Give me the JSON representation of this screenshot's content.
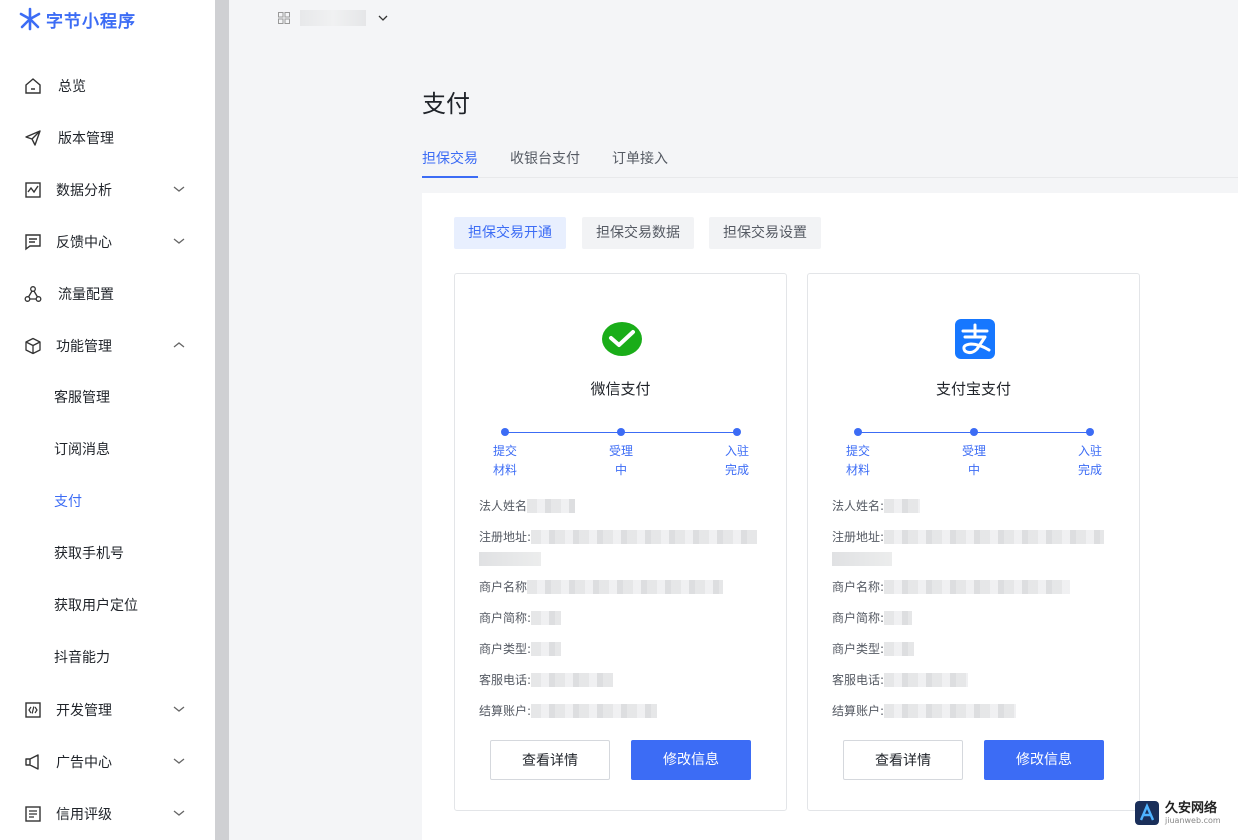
{
  "app": {
    "logo_text": "字节小程序"
  },
  "sidebar": {
    "items": [
      {
        "label": "总览",
        "icon": "home-icon"
      },
      {
        "label": "版本管理",
        "icon": "send-icon"
      },
      {
        "label": "数据分析",
        "icon": "chart-icon",
        "expandable": true
      },
      {
        "label": "反馈中心",
        "icon": "message-icon",
        "expandable": true
      },
      {
        "label": "流量配置",
        "icon": "share-icon"
      },
      {
        "label": "功能管理",
        "icon": "cube-icon",
        "expanded": true
      },
      {
        "label": "开发管理",
        "icon": "code-icon",
        "expandable": true
      },
      {
        "label": "广告中心",
        "icon": "megaphone-icon",
        "expandable": true
      },
      {
        "label": "信用评级",
        "icon": "document-icon",
        "expandable": true
      }
    ],
    "sub_items": [
      "客服管理",
      "订阅消息",
      "支付",
      "获取手机号",
      "获取用户定位",
      "抖音能力"
    ],
    "active_sub": "支付"
  },
  "page": {
    "title": "支付",
    "tabs": [
      "担保交易",
      "收银台支付",
      "订单接入"
    ],
    "active_tab": "担保交易",
    "pills": [
      "担保交易开通",
      "担保交易数据",
      "担保交易设置"
    ],
    "active_pill": "担保交易开通"
  },
  "cards": [
    {
      "name": "微信支付",
      "logo": "wechat-pay-icon",
      "steps": [
        [
          "提交",
          "材料"
        ],
        [
          "受理",
          "中"
        ],
        [
          "入驻",
          "完成"
        ]
      ],
      "fields": [
        "法人姓名",
        "注册地址:",
        "商户名称",
        "商户简称:",
        "商户类型:",
        "客服电话:",
        "结算账户:"
      ],
      "buttons": {
        "details": "查看详情",
        "edit": "修改信息"
      }
    },
    {
      "name": "支付宝支付",
      "logo": "alipay-icon",
      "steps": [
        [
          "提交",
          "材料"
        ],
        [
          "受理",
          "中"
        ],
        [
          "入驻",
          "完成"
        ]
      ],
      "fields": [
        "法人姓名:",
        "注册地址:",
        "商户名称:",
        "商户简称:",
        "商户类型:",
        "客服电话:",
        "结算账户:"
      ],
      "buttons": {
        "details": "查看详情",
        "edit": "修改信息"
      }
    }
  ],
  "watermark": {
    "title": "久安网络",
    "url": "jiuanweb.com"
  },
  "colors": {
    "accent": "#3c6cf5",
    "wechat": "#1aad19",
    "alipay": "#1677ff"
  }
}
